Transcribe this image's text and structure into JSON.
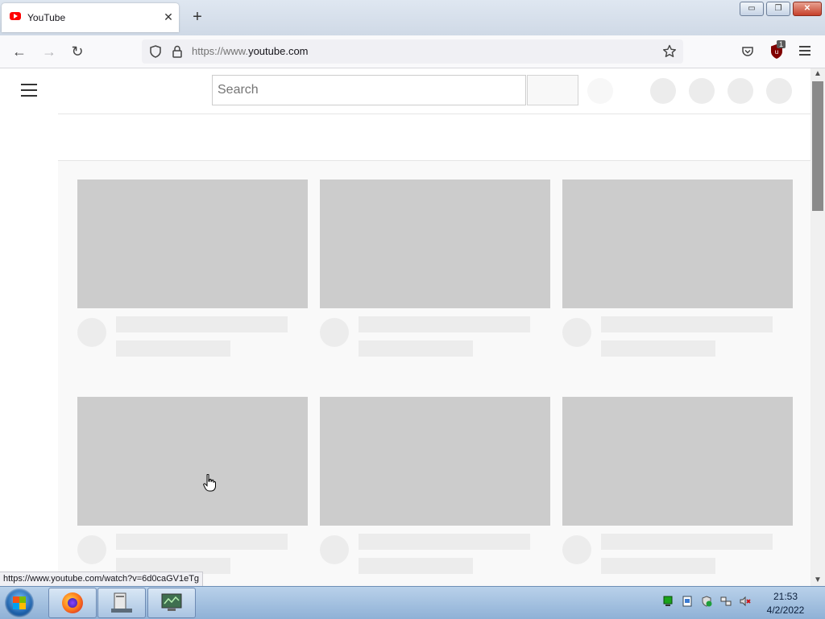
{
  "window": {
    "minimize_label": "▭",
    "restore_label": "❐",
    "close_label": "✕"
  },
  "tab": {
    "title": "YouTube",
    "close_glyph": "✕"
  },
  "new_tab_glyph": "+",
  "nav": {
    "back_glyph": "←",
    "forward_glyph": "→",
    "reload_glyph": "↻",
    "url_prefix": "https://www.",
    "url_domain": "youtube.com",
    "ublock_badge": "1"
  },
  "youtube": {
    "search_placeholder": "Search"
  },
  "status_bar_link": "https://www.youtube.com/watch?v=6d0caGV1eTg",
  "taskbar": {
    "clock_time": "21:53",
    "clock_date": "4/2/2022"
  },
  "icons": {
    "back": "arrow-left-icon",
    "forward": "arrow-right-icon",
    "reload": "reload-icon",
    "shield": "tracking-shield-icon",
    "lock": "lock-icon",
    "star": "bookmark-star-icon",
    "pocket": "pocket-icon",
    "ublock": "ublock-origin-icon",
    "menu": "hamburger-menu-icon"
  },
  "colors": {
    "youtube_red": "#ff0000",
    "skeleton_thumb": "#cccccc",
    "skeleton_text": "#ececec",
    "page_bg": "#f9f9f9"
  }
}
